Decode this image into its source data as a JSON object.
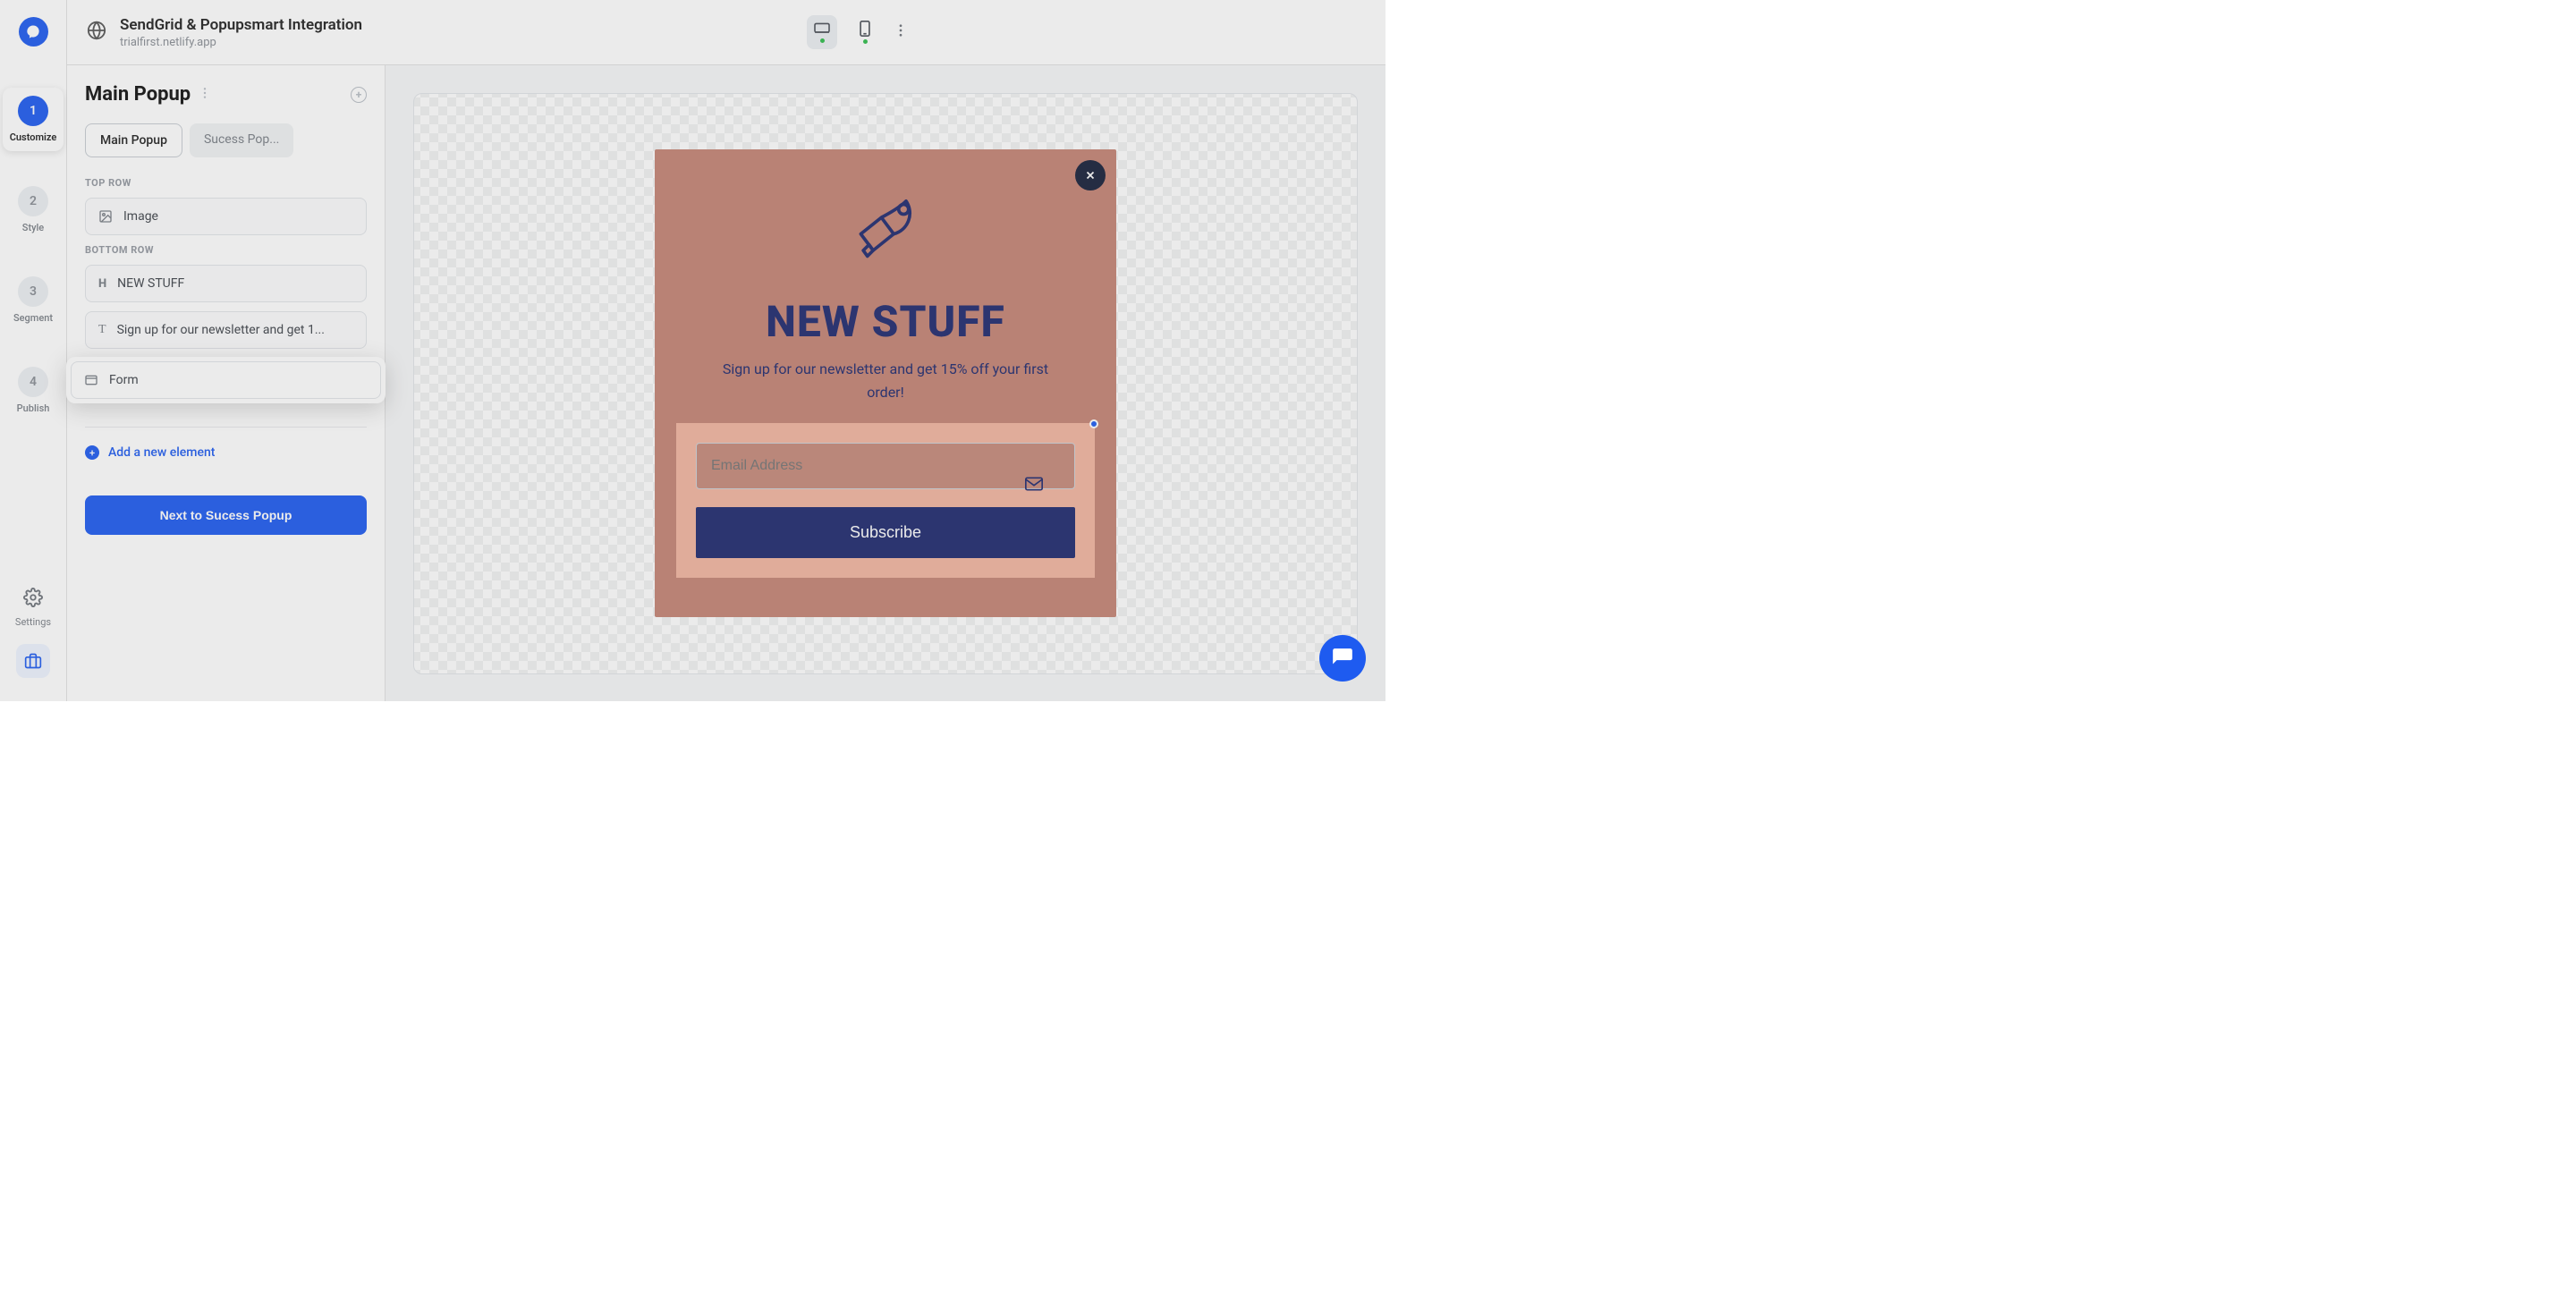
{
  "header": {
    "title": "SendGrid & Popupsmart Integration",
    "subtitle": "trialfirst.netlify.app"
  },
  "steps": {
    "customize": {
      "num": "1",
      "label": "Customize"
    },
    "style": {
      "num": "2",
      "label": "Style"
    },
    "segment": {
      "num": "3",
      "label": "Segment"
    },
    "publish": {
      "num": "4",
      "label": "Publish"
    }
  },
  "settings_label": "Settings",
  "panel": {
    "title": "Main Popup",
    "tabs": {
      "main": "Main Popup",
      "success": "Sucess Pop..."
    },
    "sections": {
      "top": "TOP ROW",
      "bottom": "BOTTOM ROW"
    },
    "rows": {
      "image": "Image",
      "heading": "NEW STUFF",
      "text": "Sign up for our newsletter and get 1...",
      "form": "Form"
    },
    "add_element": "Add a new element",
    "next_button": "Next to Sucess Popup"
  },
  "popup": {
    "heading": "NEW STUFF",
    "subtext": "Sign up for our newsletter and get 15% off your first order!",
    "email_placeholder": "Email Address",
    "subscribe_label": "Subscribe"
  },
  "colors": {
    "accent": "#1e5bf0",
    "popup_bg": "#c58475",
    "popup_dark": "#1f2a6f",
    "form_bg": "#f2b5a0"
  }
}
